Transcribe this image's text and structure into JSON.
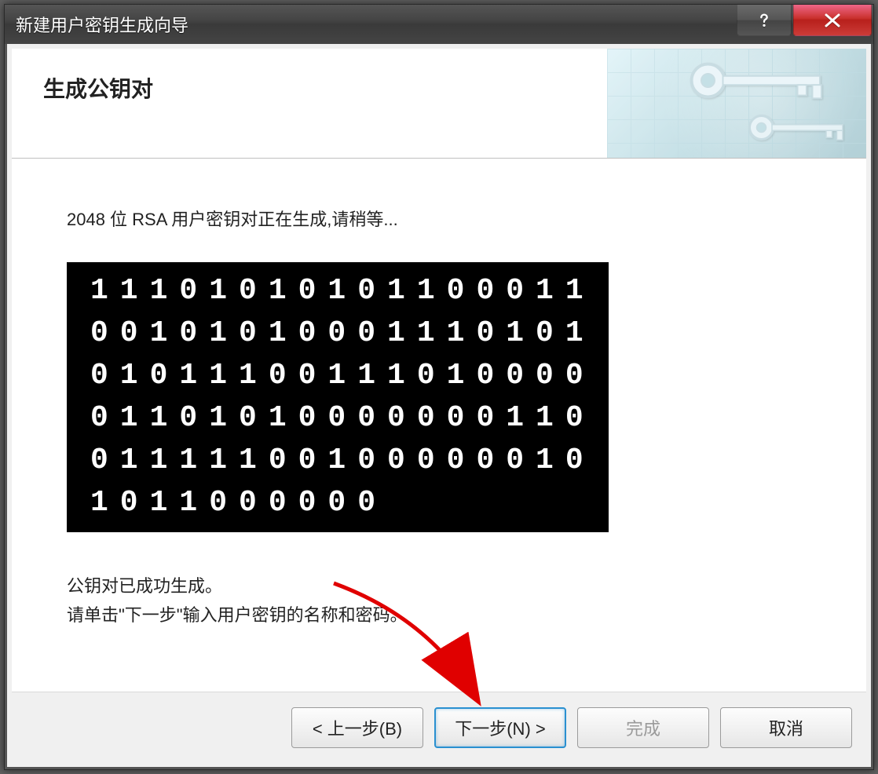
{
  "window": {
    "title": "新建用户密钥生成向导"
  },
  "header": {
    "title": "生成公钥对"
  },
  "content": {
    "status_text": "2048 位 RSA 用户密钥对正在生成,请稍等...",
    "binary": "11101010101100011001010100011101010101110011101000001101010000000110011111001000000101011000000",
    "success_line": "公钥对已成功生成。",
    "instruction_line": "请单击\"下一步\"输入用户密钥的名称和密码。"
  },
  "buttons": {
    "back": "< 上一步(B)",
    "next": "下一步(N) >",
    "finish": "完成",
    "cancel": "取消"
  }
}
